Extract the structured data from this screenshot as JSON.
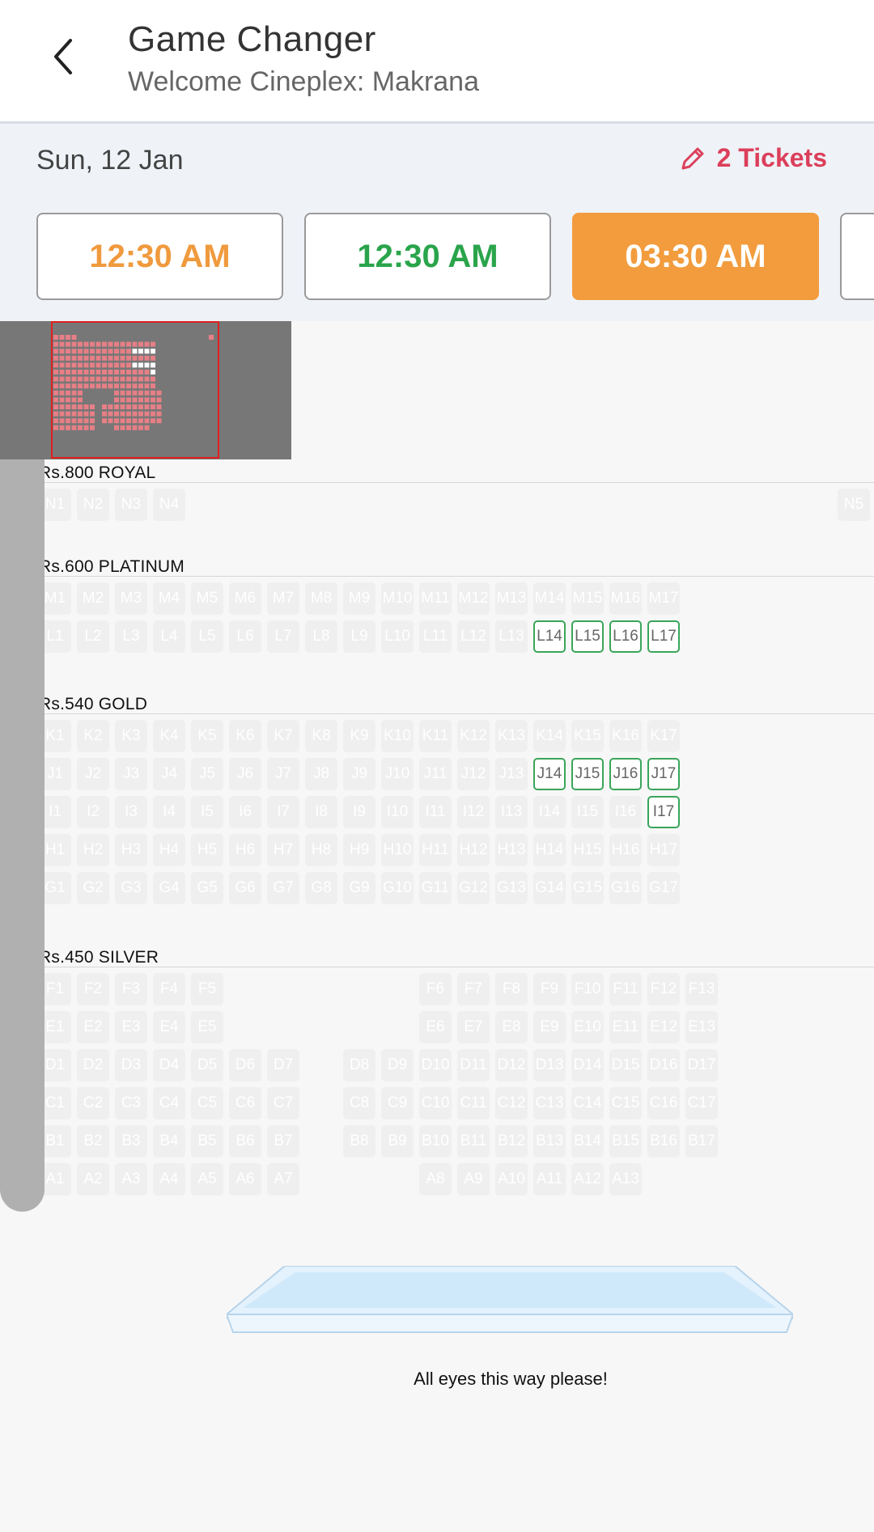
{
  "header": {
    "title": "Game Changer",
    "subtitle": "Welcome Cineplex: Makrana"
  },
  "date_bar": {
    "date": "Sun, 12 Jan",
    "tickets": "2 Tickets"
  },
  "showtimes": [
    {
      "label": "12:30 AM",
      "color": "#f09a3e",
      "selected": false
    },
    {
      "label": "12:30 AM",
      "color": "#2aa44b",
      "selected": false
    },
    {
      "label": "03:30 AM",
      "color": "#ffffff",
      "selected": true
    }
  ],
  "colors": {
    "accent": "#f29c3e",
    "available_border": "#3aa55a",
    "unavailable": "#efefef",
    "tickets": "#dc3f5b"
  },
  "sections": [
    {
      "label": "Rs.800  ROYAL",
      "rows": [
        {
          "seats": [
            {
              "id": "N1",
              "c": 0
            },
            {
              "id": "N2",
              "c": 1
            },
            {
              "id": "N3",
              "c": 2
            },
            {
              "id": "N4",
              "c": 3
            },
            {
              "id": "N5",
              "c": 21
            }
          ]
        }
      ]
    },
    {
      "label": "Rs.600  PLATINUM",
      "rows": [
        {
          "seats": [
            {
              "id": "M1",
              "c": 0
            },
            {
              "id": "M2",
              "c": 1
            },
            {
              "id": "M3",
              "c": 2
            },
            {
              "id": "M4",
              "c": 3
            },
            {
              "id": "M5",
              "c": 4
            },
            {
              "id": "M6",
              "c": 5
            },
            {
              "id": "M7",
              "c": 6
            },
            {
              "id": "M8",
              "c": 7
            },
            {
              "id": "M9",
              "c": 8
            },
            {
              "id": "M10",
              "c": 9
            },
            {
              "id": "M11",
              "c": 10
            },
            {
              "id": "M12",
              "c": 11
            },
            {
              "id": "M13",
              "c": 12
            },
            {
              "id": "M14",
              "c": 13
            },
            {
              "id": "M15",
              "c": 14
            },
            {
              "id": "M16",
              "c": 15
            },
            {
              "id": "M17",
              "c": 16
            }
          ]
        },
        {
          "seats": [
            {
              "id": "L1",
              "c": 0
            },
            {
              "id": "L2",
              "c": 1
            },
            {
              "id": "L3",
              "c": 2
            },
            {
              "id": "L4",
              "c": 3
            },
            {
              "id": "L5",
              "c": 4
            },
            {
              "id": "L6",
              "c": 5
            },
            {
              "id": "L7",
              "c": 6
            },
            {
              "id": "L8",
              "c": 7
            },
            {
              "id": "L9",
              "c": 8
            },
            {
              "id": "L10",
              "c": 9
            },
            {
              "id": "L11",
              "c": 10
            },
            {
              "id": "L12",
              "c": 11
            },
            {
              "id": "L13",
              "c": 12
            },
            {
              "id": "L14",
              "c": 13,
              "a": true
            },
            {
              "id": "L15",
              "c": 14,
              "a": true
            },
            {
              "id": "L16",
              "c": 15,
              "a": true
            },
            {
              "id": "L17",
              "c": 16,
              "a": true
            }
          ]
        }
      ]
    },
    {
      "label": "Rs.540  GOLD",
      "rows": [
        {
          "seats": [
            {
              "id": "K1",
              "c": 0
            },
            {
              "id": "K2",
              "c": 1
            },
            {
              "id": "K3",
              "c": 2
            },
            {
              "id": "K4",
              "c": 3
            },
            {
              "id": "K5",
              "c": 4
            },
            {
              "id": "K6",
              "c": 5
            },
            {
              "id": "K7",
              "c": 6
            },
            {
              "id": "K8",
              "c": 7
            },
            {
              "id": "K9",
              "c": 8
            },
            {
              "id": "K10",
              "c": 9
            },
            {
              "id": "K11",
              "c": 10
            },
            {
              "id": "K12",
              "c": 11
            },
            {
              "id": "K13",
              "c": 12
            },
            {
              "id": "K14",
              "c": 13
            },
            {
              "id": "K15",
              "c": 14
            },
            {
              "id": "K16",
              "c": 15
            },
            {
              "id": "K17",
              "c": 16
            }
          ]
        },
        {
          "seats": [
            {
              "id": "J1",
              "c": 0
            },
            {
              "id": "J2",
              "c": 1
            },
            {
              "id": "J3",
              "c": 2
            },
            {
              "id": "J4",
              "c": 3
            },
            {
              "id": "J5",
              "c": 4
            },
            {
              "id": "J6",
              "c": 5
            },
            {
              "id": "J7",
              "c": 6
            },
            {
              "id": "J8",
              "c": 7
            },
            {
              "id": "J9",
              "c": 8
            },
            {
              "id": "J10",
              "c": 9
            },
            {
              "id": "J11",
              "c": 10
            },
            {
              "id": "J12",
              "c": 11
            },
            {
              "id": "J13",
              "c": 12
            },
            {
              "id": "J14",
              "c": 13,
              "a": true
            },
            {
              "id": "J15",
              "c": 14,
              "a": true
            },
            {
              "id": "J16",
              "c": 15,
              "a": true
            },
            {
              "id": "J17",
              "c": 16,
              "a": true
            }
          ]
        },
        {
          "seats": [
            {
              "id": "I1",
              "c": 0
            },
            {
              "id": "I2",
              "c": 1
            },
            {
              "id": "I3",
              "c": 2
            },
            {
              "id": "I4",
              "c": 3
            },
            {
              "id": "I5",
              "c": 4
            },
            {
              "id": "I6",
              "c": 5
            },
            {
              "id": "I7",
              "c": 6
            },
            {
              "id": "I8",
              "c": 7
            },
            {
              "id": "I9",
              "c": 8
            },
            {
              "id": "I10",
              "c": 9
            },
            {
              "id": "I11",
              "c": 10
            },
            {
              "id": "I12",
              "c": 11
            },
            {
              "id": "I13",
              "c": 12
            },
            {
              "id": "I14",
              "c": 13
            },
            {
              "id": "I15",
              "c": 14
            },
            {
              "id": "I16",
              "c": 15
            },
            {
              "id": "I17",
              "c": 16,
              "a": true
            }
          ]
        },
        {
          "seats": [
            {
              "id": "H1",
              "c": 0
            },
            {
              "id": "H2",
              "c": 1
            },
            {
              "id": "H3",
              "c": 2
            },
            {
              "id": "H4",
              "c": 3
            },
            {
              "id": "H5",
              "c": 4
            },
            {
              "id": "H6",
              "c": 5
            },
            {
              "id": "H7",
              "c": 6
            },
            {
              "id": "H8",
              "c": 7
            },
            {
              "id": "H9",
              "c": 8
            },
            {
              "id": "H10",
              "c": 9
            },
            {
              "id": "H11",
              "c": 10
            },
            {
              "id": "H12",
              "c": 11
            },
            {
              "id": "H13",
              "c": 12
            },
            {
              "id": "H14",
              "c": 13
            },
            {
              "id": "H15",
              "c": 14
            },
            {
              "id": "H16",
              "c": 15
            },
            {
              "id": "H17",
              "c": 16
            }
          ]
        },
        {
          "seats": [
            {
              "id": "G1",
              "c": 0
            },
            {
              "id": "G2",
              "c": 1
            },
            {
              "id": "G3",
              "c": 2
            },
            {
              "id": "G4",
              "c": 3
            },
            {
              "id": "G5",
              "c": 4
            },
            {
              "id": "G6",
              "c": 5
            },
            {
              "id": "G7",
              "c": 6
            },
            {
              "id": "G8",
              "c": 7
            },
            {
              "id": "G9",
              "c": 8
            },
            {
              "id": "G10",
              "c": 9
            },
            {
              "id": "G11",
              "c": 10
            },
            {
              "id": "G12",
              "c": 11
            },
            {
              "id": "G13",
              "c": 12
            },
            {
              "id": "G14",
              "c": 13
            },
            {
              "id": "G15",
              "c": 14
            },
            {
              "id": "G16",
              "c": 15
            },
            {
              "id": "G17",
              "c": 16
            }
          ]
        }
      ]
    },
    {
      "label": "Rs.450  SILVER",
      "rows": [
        {
          "seats": [
            {
              "id": "F1",
              "c": 0
            },
            {
              "id": "F2",
              "c": 1
            },
            {
              "id": "F3",
              "c": 2
            },
            {
              "id": "F4",
              "c": 3
            },
            {
              "id": "F5",
              "c": 4
            },
            {
              "id": "F6",
              "c": 10
            },
            {
              "id": "F7",
              "c": 11
            },
            {
              "id": "F8",
              "c": 12
            },
            {
              "id": "F9",
              "c": 13
            },
            {
              "id": "F10",
              "c": 14
            },
            {
              "id": "F11",
              "c": 15
            },
            {
              "id": "F12",
              "c": 16
            },
            {
              "id": "F13",
              "c": 17
            }
          ]
        },
        {
          "seats": [
            {
              "id": "E1",
              "c": 0
            },
            {
              "id": "E2",
              "c": 1
            },
            {
              "id": "E3",
              "c": 2
            },
            {
              "id": "E4",
              "c": 3
            },
            {
              "id": "E5",
              "c": 4
            },
            {
              "id": "E6",
              "c": 10
            },
            {
              "id": "E7",
              "c": 11
            },
            {
              "id": "E8",
              "c": 12
            },
            {
              "id": "E9",
              "c": 13
            },
            {
              "id": "E10",
              "c": 14
            },
            {
              "id": "E11",
              "c": 15
            },
            {
              "id": "E12",
              "c": 16
            },
            {
              "id": "E13",
              "c": 17
            }
          ]
        },
        {
          "seats": [
            {
              "id": "D1",
              "c": 0
            },
            {
              "id": "D2",
              "c": 1
            },
            {
              "id": "D3",
              "c": 2
            },
            {
              "id": "D4",
              "c": 3
            },
            {
              "id": "D5",
              "c": 4
            },
            {
              "id": "D6",
              "c": 5
            },
            {
              "id": "D7",
              "c": 6
            },
            {
              "id": "D8",
              "c": 8
            },
            {
              "id": "D9",
              "c": 9
            },
            {
              "id": "D10",
              "c": 10
            },
            {
              "id": "D11",
              "c": 11
            },
            {
              "id": "D12",
              "c": 12
            },
            {
              "id": "D13",
              "c": 13
            },
            {
              "id": "D14",
              "c": 14
            },
            {
              "id": "D15",
              "c": 15
            },
            {
              "id": "D16",
              "c": 16
            },
            {
              "id": "D17",
              "c": 17
            }
          ]
        },
        {
          "seats": [
            {
              "id": "C1",
              "c": 0
            },
            {
              "id": "C2",
              "c": 1
            },
            {
              "id": "C3",
              "c": 2
            },
            {
              "id": "C4",
              "c": 3
            },
            {
              "id": "C5",
              "c": 4
            },
            {
              "id": "C6",
              "c": 5
            },
            {
              "id": "C7",
              "c": 6
            },
            {
              "id": "C8",
              "c": 8
            },
            {
              "id": "C9",
              "c": 9
            },
            {
              "id": "C10",
              "c": 10
            },
            {
              "id": "C11",
              "c": 11
            },
            {
              "id": "C12",
              "c": 12
            },
            {
              "id": "C13",
              "c": 13
            },
            {
              "id": "C14",
              "c": 14
            },
            {
              "id": "C15",
              "c": 15
            },
            {
              "id": "C16",
              "c": 16
            },
            {
              "id": "C17",
              "c": 17
            }
          ]
        },
        {
          "seats": [
            {
              "id": "B1",
              "c": 0
            },
            {
              "id": "B2",
              "c": 1
            },
            {
              "id": "B3",
              "c": 2
            },
            {
              "id": "B4",
              "c": 3
            },
            {
              "id": "B5",
              "c": 4
            },
            {
              "id": "B6",
              "c": 5
            },
            {
              "id": "B7",
              "c": 6
            },
            {
              "id": "B8",
              "c": 8
            },
            {
              "id": "B9",
              "c": 9
            },
            {
              "id": "B10",
              "c": 10
            },
            {
              "id": "B11",
              "c": 11
            },
            {
              "id": "B12",
              "c": 12
            },
            {
              "id": "B13",
              "c": 13
            },
            {
              "id": "B14",
              "c": 14
            },
            {
              "id": "B15",
              "c": 15
            },
            {
              "id": "B16",
              "c": 16
            },
            {
              "id": "B17",
              "c": 17
            }
          ]
        },
        {
          "seats": [
            {
              "id": "A1",
              "c": 0
            },
            {
              "id": "A2",
              "c": 1
            },
            {
              "id": "A3",
              "c": 2
            },
            {
              "id": "A4",
              "c": 3
            },
            {
              "id": "A5",
              "c": 4
            },
            {
              "id": "A6",
              "c": 5
            },
            {
              "id": "A7",
              "c": 6
            },
            {
              "id": "A8",
              "c": 10
            },
            {
              "id": "A9",
              "c": 11
            },
            {
              "id": "A10",
              "c": 12
            },
            {
              "id": "A11",
              "c": 13
            },
            {
              "id": "A12",
              "c": 14
            },
            {
              "id": "A13",
              "c": 15
            }
          ]
        }
      ]
    }
  ],
  "screen": {
    "caption": "All eyes this way please!"
  }
}
